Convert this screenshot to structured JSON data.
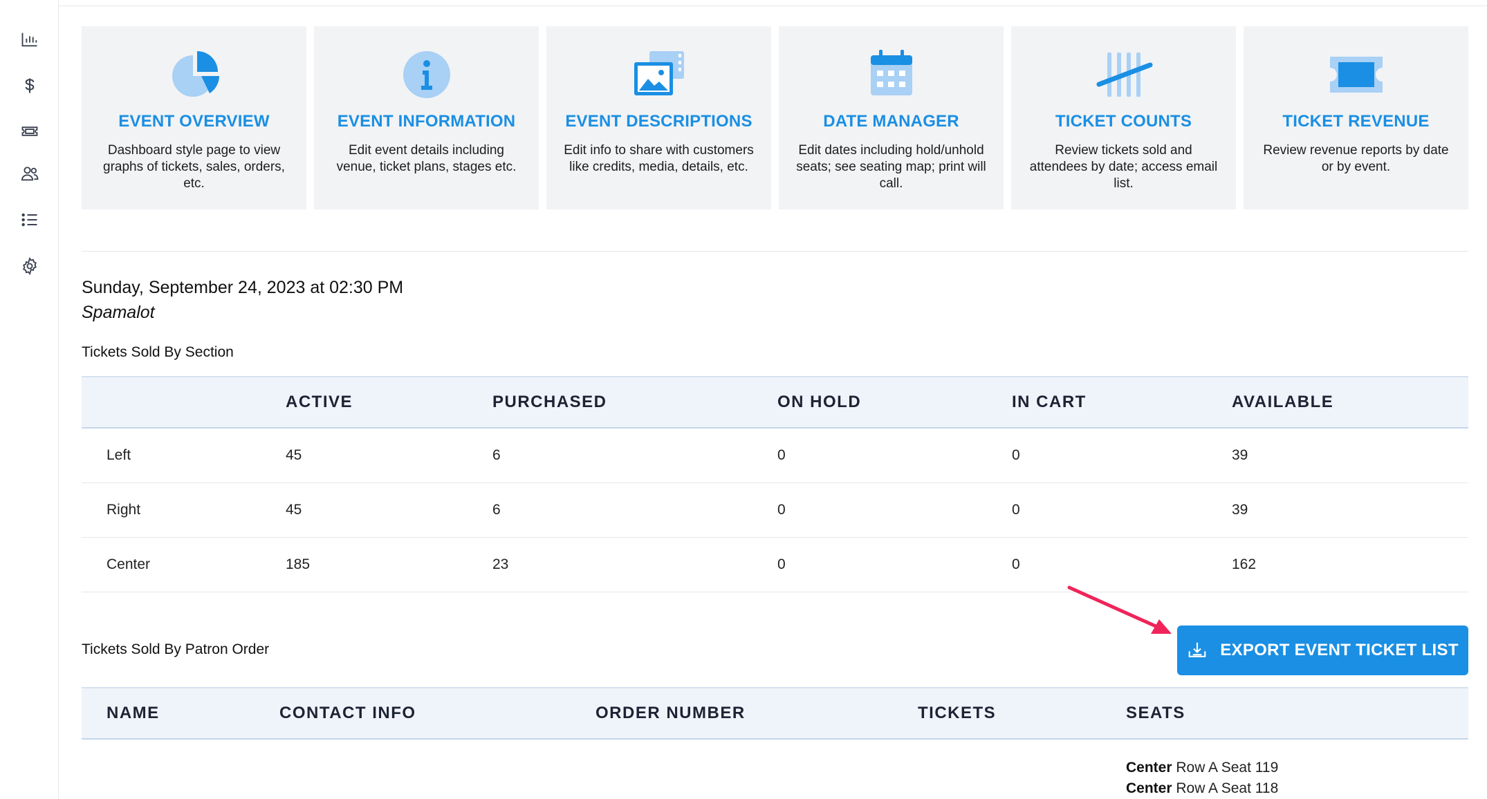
{
  "sidebar": {
    "icons": [
      "bar-chart-icon",
      "dollar-icon",
      "ticket-icon",
      "users-icon",
      "list-icon",
      "gear-icon"
    ]
  },
  "cards": [
    {
      "title": "EVENT OVERVIEW",
      "description": "Dashboard style page to view graphs of tickets, sales, orders, etc.",
      "icon": "pie-chart-icon"
    },
    {
      "title": "EVENT INFORMATION",
      "description": "Edit event details including venue, ticket plans, stages etc.",
      "icon": "info-icon"
    },
    {
      "title": "EVENT DESCRIPTIONS",
      "description": "Edit info to share with customers like credits, media, details, etc.",
      "icon": "media-icon"
    },
    {
      "title": "DATE MANAGER",
      "description": "Edit dates including hold/unhold seats; see seating map; print will call.",
      "icon": "calendar-icon"
    },
    {
      "title": "TICKET COUNTS",
      "description": "Review tickets sold and attendees by date; access email list.",
      "icon": "tally-icon"
    },
    {
      "title": "TICKET REVENUE",
      "description": "Review revenue reports by date or by event.",
      "icon": "ticket-icon"
    }
  ],
  "event": {
    "date": "Sunday, September 24, 2023 at 02:30 PM",
    "name": "Spamalot"
  },
  "sections_table": {
    "title": "Tickets Sold By Section",
    "headers": [
      "",
      "ACTIVE",
      "PURCHASED",
      "ON HOLD",
      "IN CART",
      "AVAILABLE"
    ],
    "rows": [
      [
        "Left",
        "45",
        "6",
        "0",
        "0",
        "39"
      ],
      [
        "Right",
        "45",
        "6",
        "0",
        "0",
        "39"
      ],
      [
        "Center",
        "185",
        "23",
        "0",
        "0",
        "162"
      ]
    ]
  },
  "patron_table": {
    "title": "Tickets Sold By Patron Order",
    "export_label": "EXPORT EVENT TICKET LIST",
    "headers": [
      "NAME",
      "CONTACT INFO",
      "ORDER NUMBER",
      "TICKETS",
      "SEATS"
    ],
    "seats": [
      {
        "section": "Center",
        "detail": "Row A Seat 119"
      },
      {
        "section": "Center",
        "detail": "Row A Seat 118"
      }
    ]
  },
  "colors": {
    "accent": "#1a8fe3",
    "card_bg": "#f2f3f5",
    "table_header_bg": "#eff4fb",
    "annotation_arrow": "#f0245a"
  }
}
